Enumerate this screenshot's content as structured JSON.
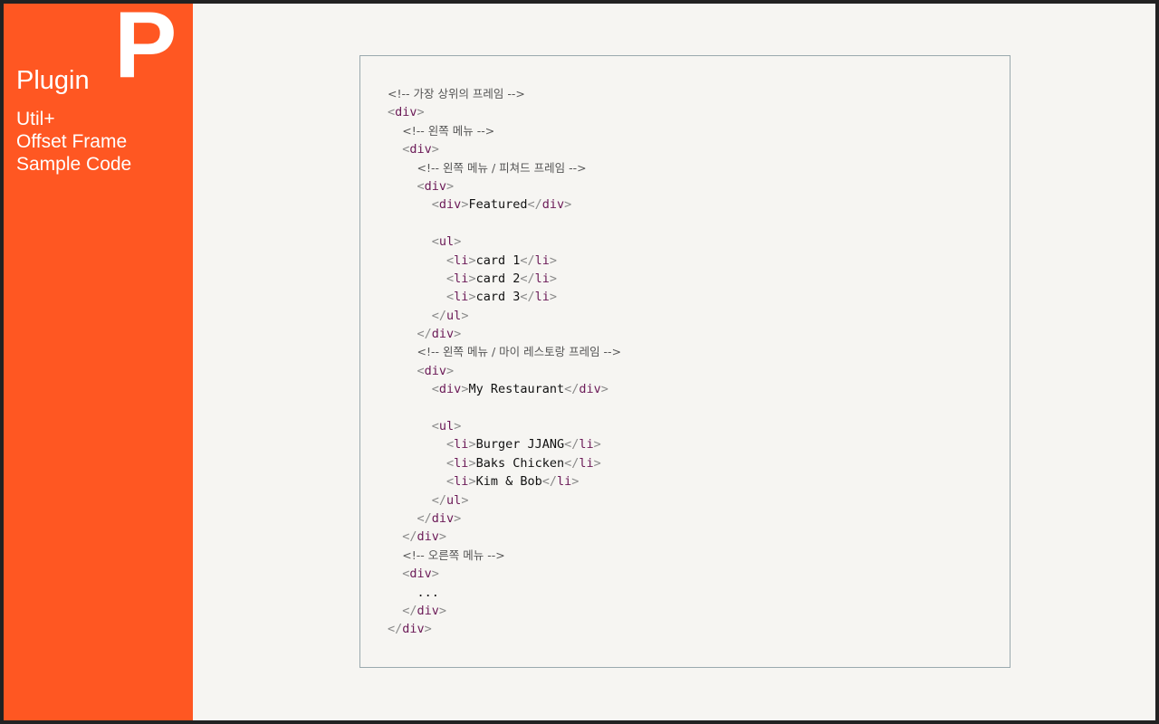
{
  "sidebar": {
    "big_letter": "P",
    "title": "Plugin",
    "subtitle_lines": [
      "Util+",
      "Offset Frame",
      "Sample Code"
    ]
  },
  "colors": {
    "accent": "#ff5722",
    "background": "#f6f5f2",
    "tag": "#6b1a57",
    "punctuation": "#8a8a8a",
    "border": "#9aa9ae"
  },
  "code": {
    "comment_top": "<!-- 가장 상위의 프레임 -->",
    "comment_left_menu": "<!-- 왼쪽 메뉴 -->",
    "comment_featured": "<!-- 왼쪽 메뉴 / 피쳐드 프레임 -->",
    "featured_text": "Featured",
    "cards": [
      "card 1",
      "card 2",
      "card 3"
    ],
    "comment_my_restaurant": "<!-- 왼쪽 메뉴 / 마이 레스토랑 프레임 -->",
    "my_restaurant_text": "My Restaurant",
    "restaurants": [
      "Burger JJANG",
      "Baks Chicken",
      "Kim & Bob"
    ],
    "comment_right_menu": "<!-- 오른쪽 메뉴 -->",
    "ellipsis": "..."
  }
}
